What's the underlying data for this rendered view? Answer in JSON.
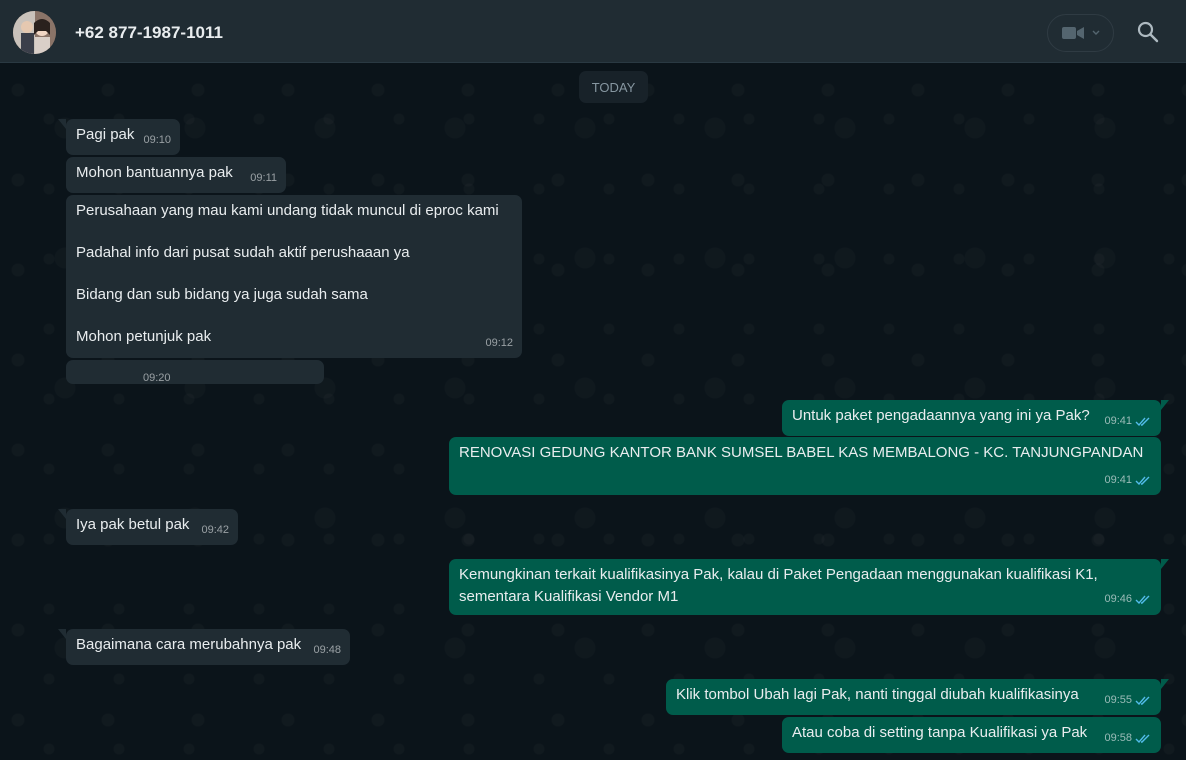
{
  "header": {
    "contact_name": "+62 877-1987-1011"
  },
  "icons": {
    "video": "video-camera-icon",
    "dropdown": "chevron-down-icon",
    "search": "search-icon",
    "read_receipt": "double-check-icon"
  },
  "colors": {
    "header_bg": "#202c33",
    "chat_bg": "#0b141a",
    "incoming_bubble": "#202c33",
    "outgoing_bubble": "#005c4b",
    "read_tick": "#53bdeb"
  },
  "chat": {
    "day_label": "TODAY",
    "messages": [
      {
        "direction": "in",
        "text": "Pagi pak",
        "time": "09:10"
      },
      {
        "direction": "in",
        "text": "Mohon bantuannya pak",
        "time": "09:11"
      },
      {
        "direction": "in",
        "paragraphs": [
          "Perusahaan yang mau kami undang tidak muncul di eproc kami",
          "Padahal info dari pusat sudah aktif perushaaan ya",
          "Bidang dan sub bidang ya juga sudah sama",
          "Mohon petunjuk pak"
        ],
        "time": "09:12"
      },
      {
        "direction": "in",
        "text": "",
        "time": "09:20"
      },
      {
        "direction": "out",
        "text": "Untuk paket pengadaannya yang ini ya Pak?",
        "time": "09:41"
      },
      {
        "direction": "out",
        "text": "RENOVASI GEDUNG KANTOR BANK SUMSEL BABEL KAS MEMBALONG - KC. TANJUNGPANDAN",
        "time": "09:41"
      },
      {
        "direction": "in",
        "text": "Iya pak betul pak",
        "time": "09:42"
      },
      {
        "direction": "out",
        "lines": [
          "Kemungkinan terkait kualifikasinya Pak, kalau di Paket Pengadaan menggunakan kualifikasi K1,",
          "sementara Kualifikasi Vendor M1"
        ],
        "time": "09:46"
      },
      {
        "direction": "in",
        "text": "Bagaimana cara merubahnya pak",
        "time": "09:48"
      },
      {
        "direction": "out",
        "text": "Klik tombol Ubah lagi Pak, nanti tinggal diubah kualifikasinya",
        "time": "09:55"
      },
      {
        "direction": "out",
        "text": "Atau coba di setting tanpa Kualifikasi ya Pak",
        "time": "09:58"
      }
    ]
  }
}
